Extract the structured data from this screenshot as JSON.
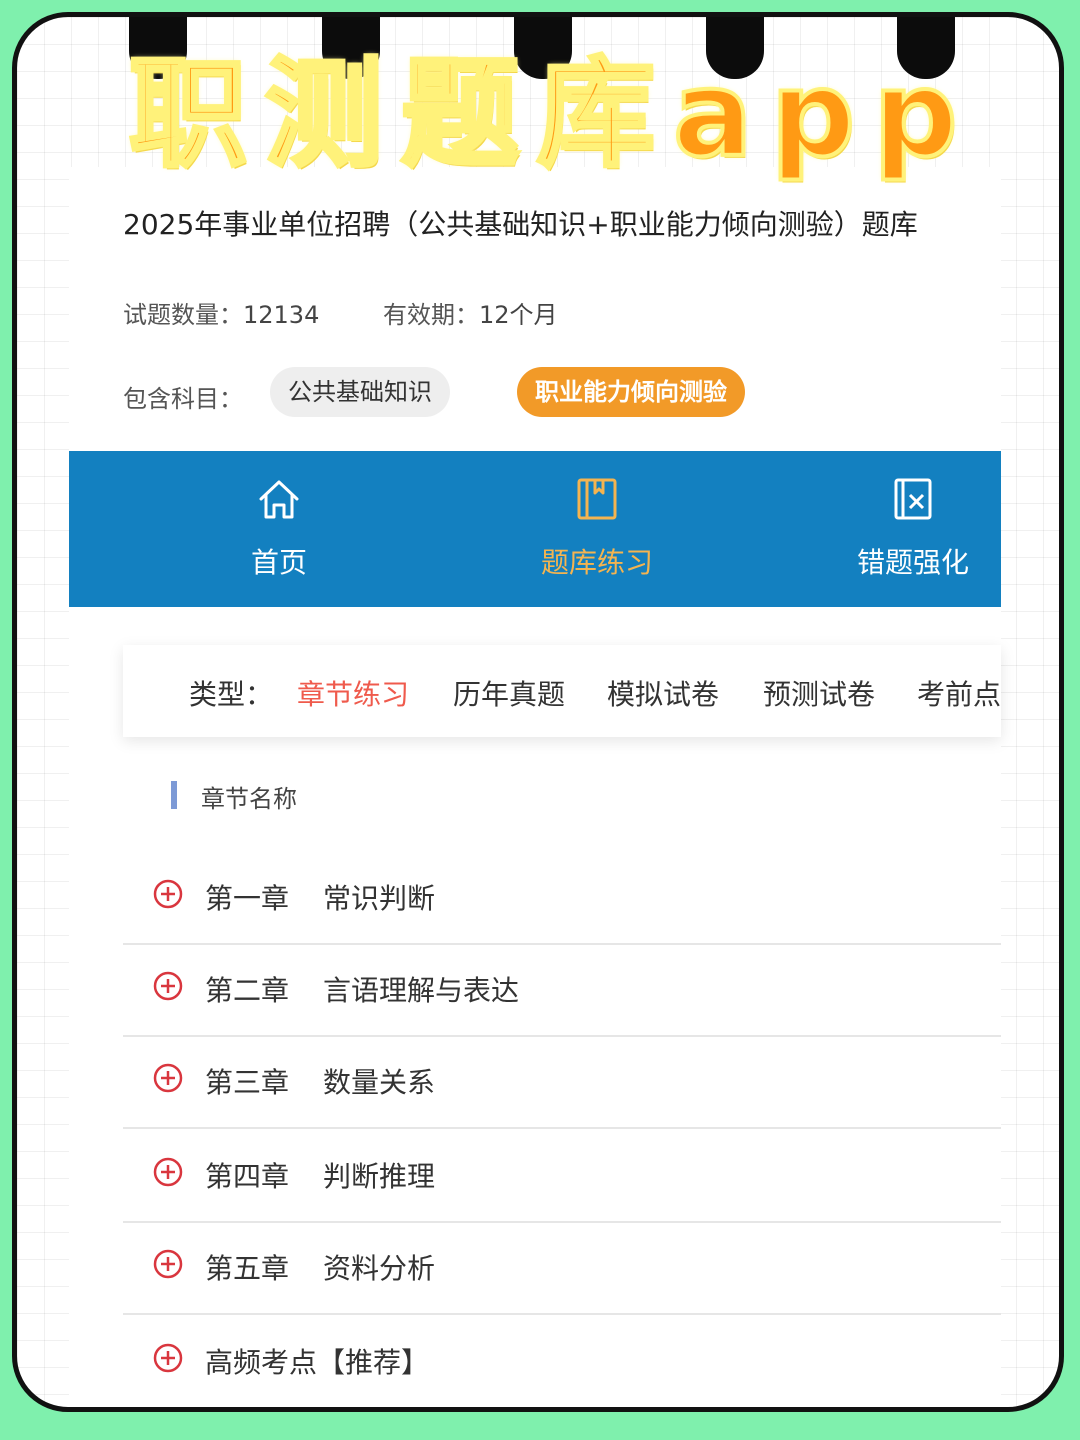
{
  "banner": {
    "title": "职测题库app"
  },
  "product": {
    "title": "2025年事业单位招聘（公共基础知识+职业能力倾向测验）题库",
    "question_count_label": "试题数量：",
    "question_count": "12134",
    "validity_label": "有效期：",
    "validity": "12个月",
    "subjects_label": "包含科目：",
    "subjects": [
      "公共基础知识",
      "职业能力倾向测验"
    ]
  },
  "nav": {
    "items": [
      {
        "label": "首页",
        "icon": "home-icon"
      },
      {
        "label": "题库练习",
        "icon": "book-icon"
      },
      {
        "label": "错题强化",
        "icon": "wrong-question-icon"
      }
    ],
    "active_index": 1,
    "bar_color": "#1380c0",
    "active_color": "#f4b450"
  },
  "types": {
    "label": "类型：",
    "items": [
      "章节练习",
      "历年真题",
      "模拟试卷",
      "预测试卷",
      "考前点"
    ],
    "active_index": 0,
    "active_color": "#ef5a4c"
  },
  "chapters": {
    "heading": "章节名称",
    "items": [
      {
        "num": "第一章",
        "title": "常识判断"
      },
      {
        "num": "第二章",
        "title": "言语理解与表达"
      },
      {
        "num": "第三章",
        "title": "数量关系"
      },
      {
        "num": "第四章",
        "title": "判断推理"
      },
      {
        "num": "第五章",
        "title": "资料分析"
      },
      {
        "num": "",
        "title": "高频考点【推荐】"
      }
    ]
  }
}
